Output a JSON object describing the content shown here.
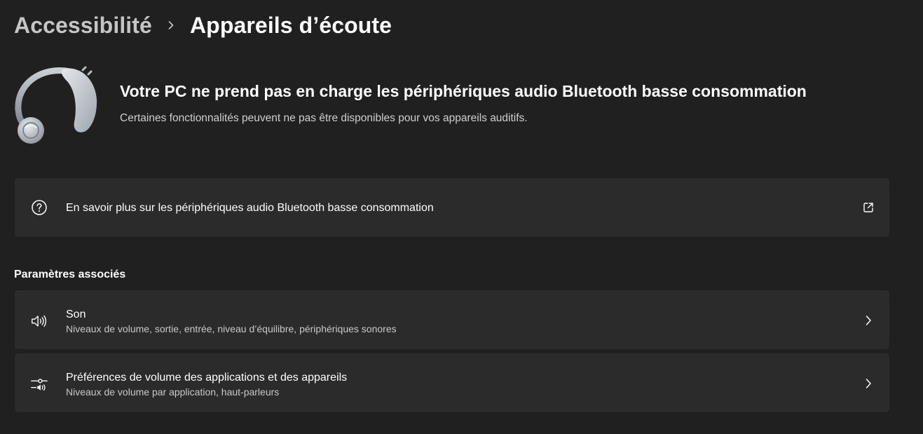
{
  "breadcrumb": {
    "parent": "Accessibilité",
    "current": "Appareils d’écoute"
  },
  "banner": {
    "title": "Votre PC ne prend pas en charge les périphériques audio Bluetooth basse consommation",
    "description": "Certaines fonctionnalités peuvent ne pas être disponibles pour vos appareils auditifs.",
    "illustration": "hearing-aid-illustration"
  },
  "learn_more": {
    "label": "En savoir plus sur les périphériques audio Bluetooth basse consommation",
    "icon": "help-circle-icon",
    "trailing_icon": "external-link-icon"
  },
  "related_settings": {
    "heading": "Paramètres associés",
    "items": [
      {
        "title": "Son",
        "subtitle": "Niveaux de volume, sortie, entrée, niveau d’équilibre, périphériques sonores",
        "icon": "speaker-icon"
      },
      {
        "title": "Préférences de volume des applications et des appareils",
        "subtitle": "Niveaux de volume par application, haut-parleurs",
        "icon": "volume-mixer-icon"
      }
    ]
  },
  "colors": {
    "background": "#202020",
    "card": "#2b2b2b",
    "text_primary": "#ffffff",
    "text_secondary": "#c8c8c8"
  }
}
